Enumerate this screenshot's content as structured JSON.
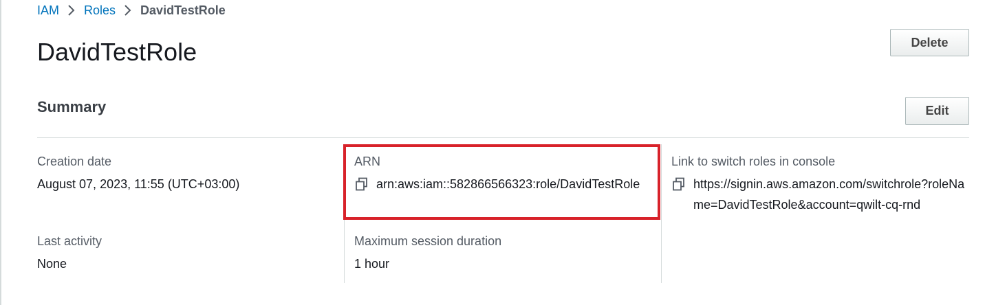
{
  "breadcrumb": {
    "items": [
      "IAM",
      "Roles"
    ],
    "current": "DavidTestRole"
  },
  "header": {
    "title": "DavidTestRole",
    "delete_label": "Delete"
  },
  "summary": {
    "title": "Summary",
    "edit_label": "Edit",
    "creation_date": {
      "label": "Creation date",
      "value": "August 07, 2023, 11:55 (UTC+03:00)"
    },
    "arn": {
      "label": "ARN",
      "value": "arn:aws:iam::582866566323:role/DavidTestRole"
    },
    "switch_link": {
      "label": "Link to switch roles in console",
      "value": "https://signin.aws.amazon.com/switchrole?roleName=DavidTestRole&account=qwilt-cq-rnd"
    },
    "last_activity": {
      "label": "Last activity",
      "value": "None"
    },
    "max_session": {
      "label": "Maximum session duration",
      "value": "1 hour"
    }
  },
  "colors": {
    "link": "#0073bb",
    "highlight": "#d8222a",
    "divider": "#d5dbdb"
  },
  "icons": [
    "chevron-right-icon",
    "copy-icon"
  ]
}
